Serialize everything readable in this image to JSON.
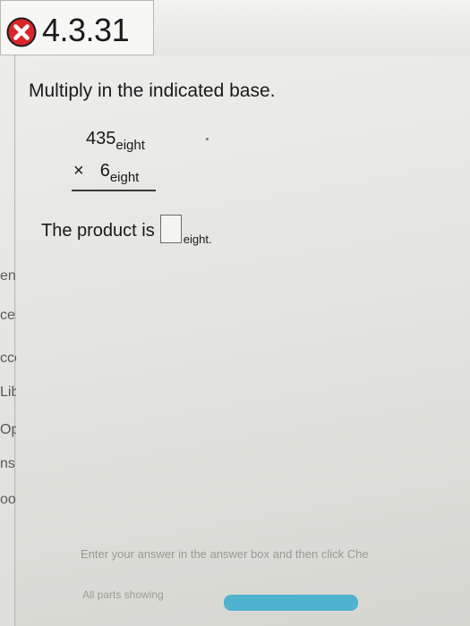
{
  "header": {
    "problem_id": "4.3.31",
    "status_icon": "incorrect-x-icon",
    "status_color": "#d9262b"
  },
  "nav": {
    "items": [
      {
        "label": "ents"
      },
      {
        "label": "cess"
      },
      {
        "label": "ccess"
      },
      {
        "label": "Librar"
      },
      {
        "label": "Options"
      },
      {
        "label": "ns"
      },
      {
        "label": "ools"
      }
    ]
  },
  "question": {
    "instruction": "Multiply in the indicated base.",
    "multiplicand": {
      "digits": "435",
      "base": "eight"
    },
    "multiplier": {
      "sign": "×",
      "digits": "6",
      "base": "eight"
    },
    "product_prefix": "The product is",
    "product_base": "eight",
    "product_suffix": "."
  },
  "footer": {
    "hint": "Enter your answer in the answer box and then click Che",
    "parts_label": "All parts showing",
    "progress_color": "#4fb2cf",
    "progress_fraction": 1.0
  }
}
